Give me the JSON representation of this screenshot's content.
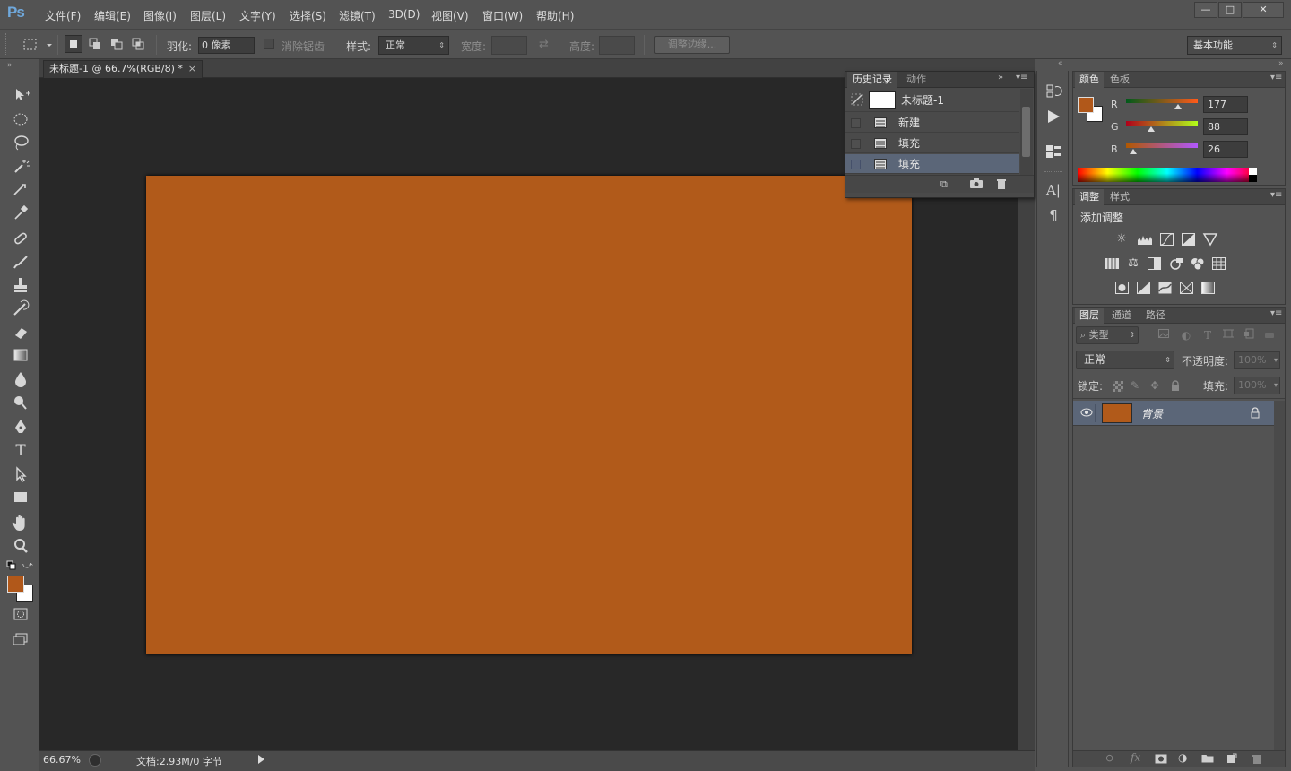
{
  "app": {
    "logo": "Ps"
  },
  "menu": [
    "文件(F)",
    "编辑(E)",
    "图像(I)",
    "图层(L)",
    "文字(Y)",
    "选择(S)",
    "滤镜(T)",
    "3D(D)",
    "视图(V)",
    "窗口(W)",
    "帮助(H)"
  ],
  "window_controls": {
    "minimize": "—",
    "maximize": "□",
    "close": "✕"
  },
  "options": {
    "feather_label": "羽化:",
    "feather_value": "0 像素",
    "antialias_label": "消除锯齿",
    "style_label": "样式:",
    "style_value": "正常",
    "width_label": "宽度:",
    "height_label": "高度:",
    "refine_edge": "调整边缘...",
    "workspace": "基本功能"
  },
  "document": {
    "tab_title": "未标题-1 @ 66.7%(RGB/8) *",
    "close": "×",
    "zoom": "66.67%",
    "doc_info": "文档:2.93M/0 字节",
    "fill_color": "#b15a1a",
    "canvas_bg": "#282828"
  },
  "history_panel": {
    "tabs": [
      "历史记录",
      "动作"
    ],
    "snapshot": "未标题-1",
    "states": [
      "新建",
      "填充",
      "填充"
    ],
    "active_state_index": 2
  },
  "color_panel": {
    "tabs": [
      "颜色",
      "色板"
    ],
    "foreground": "#b1581a",
    "background": "#ffffff",
    "channels": [
      {
        "label": "R",
        "value": "177"
      },
      {
        "label": "G",
        "value": "88"
      },
      {
        "label": "B",
        "value": "26"
      }
    ]
  },
  "adjustments_panel": {
    "tabs": [
      "调整",
      "样式"
    ],
    "title": "添加调整"
  },
  "layers_panel": {
    "tabs": [
      "图层",
      "通道",
      "路径"
    ],
    "filter_kind": "类型",
    "blend_mode": "正常",
    "opacity_label": "不透明度:",
    "opacity_value": "100%",
    "lock_label": "锁定:",
    "fill_label": "填充:",
    "fill_value": "100%",
    "layers": [
      {
        "name": "背景",
        "thumb_color": "#b15a1a",
        "visible": true,
        "locked": true
      }
    ]
  }
}
